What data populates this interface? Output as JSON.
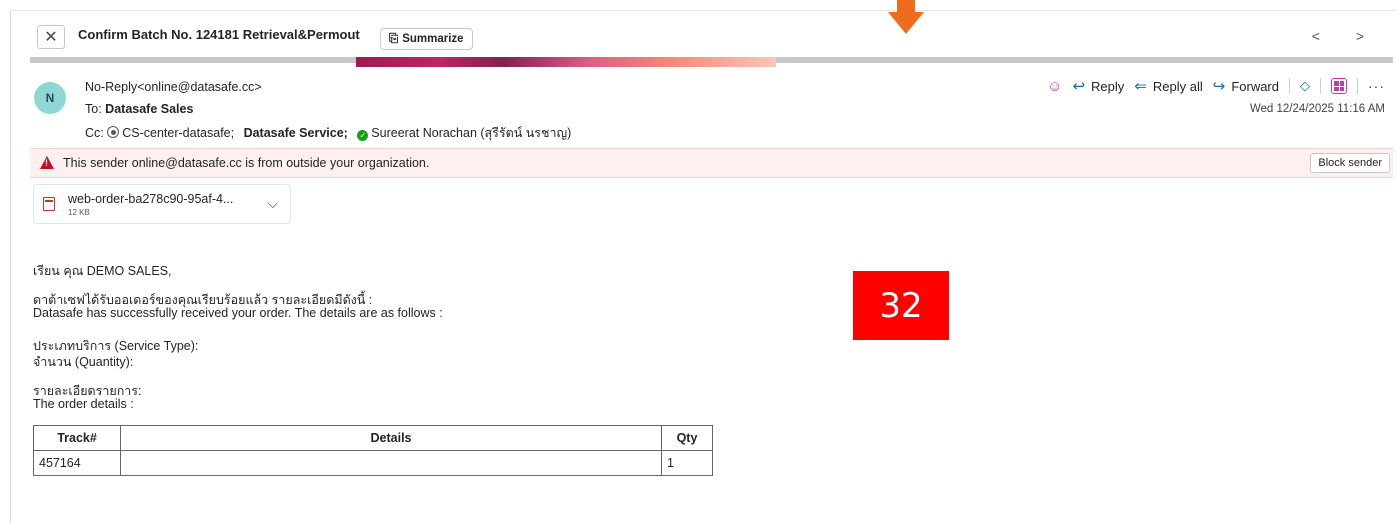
{
  "header": {
    "subject": "Confirm Batch No. 124181 Retrieval&Permout",
    "summarize_label": "Summarize",
    "nav": "< >"
  },
  "sender": {
    "avatar_initial": "N",
    "from": "No-Reply<online@datasafe.cc>",
    "to_label": "To:",
    "to_name": "Datasafe Sales",
    "cc_label": "Cc:",
    "cc_1": "CS-center-datasafe;",
    "cc_2": "Datasafe Service;",
    "cc_3": "Sureerat Norachan (สุรีรัตน์ นรชาญ)",
    "date": "Wed 12/24/2025 11:16 AM"
  },
  "actions": {
    "reply": "Reply",
    "reply_all": "Reply all",
    "forward": "Forward"
  },
  "warning": {
    "text": "This sender online@datasafe.cc is from outside your organization.",
    "block_label": "Block sender"
  },
  "attachment": {
    "name": "web-order-ba278c90-95af-4...",
    "size": "12 KB"
  },
  "body": {
    "greeting": "เรียน คุณ DEMO SALES,",
    "line_th": "ดาต้าเซฟได้รับออเดอร์ของคุณเรียบร้อยแล้ว รายละเอียดมีดังนี้ :",
    "line_en": "Datasafe has successfully received your order. The details are as follows :",
    "service_type": "ประเภทบริการ (Service Type):",
    "quantity": "จำนวน (Quantity):",
    "details_th": "รายละเอียดรายการ:",
    "details_en": "The order details :"
  },
  "badge": "32",
  "table": {
    "headers": [
      "Track#",
      "Details",
      "Qty"
    ],
    "rows": [
      [
        "457164",
        "",
        "1"
      ]
    ]
  },
  "colors": {
    "accent": "#0f6cbd",
    "warning_bg": "#fdf0ef",
    "badge": "#ff0000",
    "arrow": "#ef6c1e"
  }
}
